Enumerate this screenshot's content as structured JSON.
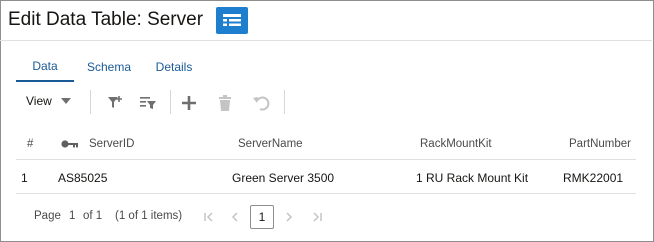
{
  "header": {
    "title": "Edit Data Table: Server",
    "badge_icon": "table-icon",
    "badge_color": "#1f7fcf"
  },
  "tabs": [
    {
      "label": "Data",
      "active": true
    },
    {
      "label": "Schema",
      "active": false
    },
    {
      "label": "Details",
      "active": false
    }
  ],
  "toolbar": {
    "view_label": "View",
    "icons": [
      "filter-add-icon",
      "filter-rows-icon",
      "add-icon",
      "delete-icon",
      "undo-icon"
    ]
  },
  "table": {
    "columns": [
      "#",
      "ServerID",
      "ServerName",
      "RackMountKit",
      "PartNumber"
    ],
    "key_icon": "key-icon",
    "rows": [
      [
        "1",
        "AS85025",
        "Green Server 3500",
        "1 RU Rack Mount Kit",
        "RMK22001"
      ]
    ]
  },
  "pager": {
    "page_label": "Page",
    "current_page": "1",
    "of_label": "of 1",
    "items_label": "(1 of 1 items)",
    "page_button": "1"
  },
  "colors": {
    "accent": "#1a5a96",
    "disabled_icon": "#c4c4c4",
    "icon": "#6f6f6f"
  }
}
